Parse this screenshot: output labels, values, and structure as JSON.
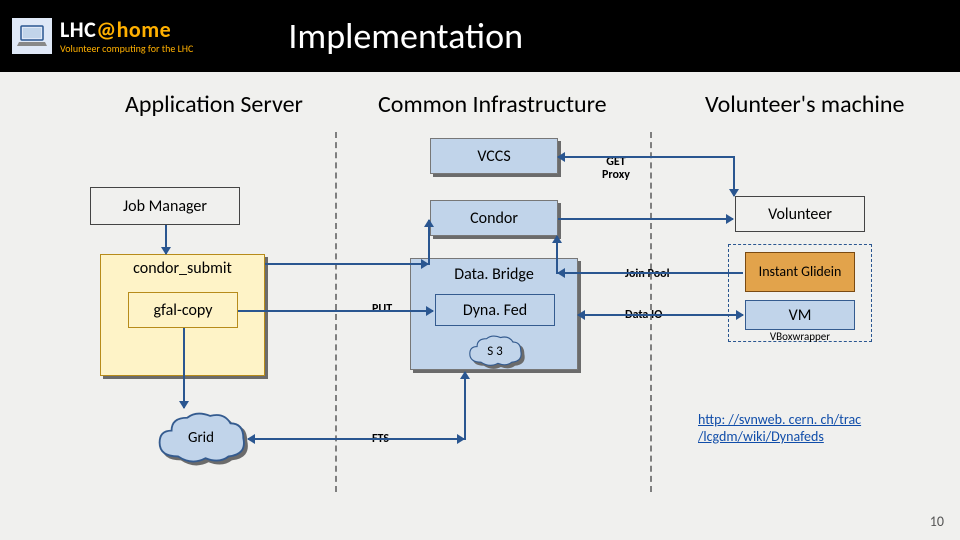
{
  "header": {
    "brand_prefix": "LHC",
    "brand_suffix": "@home",
    "tagline": "Volunteer computing for the LHC",
    "title": "Implementation"
  },
  "columns": {
    "left": "Application Server",
    "mid": "Common Infrastructure",
    "right": "Volunteer's machine"
  },
  "boxes": {
    "job_manager": "Job Manager",
    "condor_submit": "condor_submit",
    "gfal_copy": "gfal-copy",
    "vccs": "VCCS",
    "condor": "Condor",
    "data_bridge": "Data. Bridge",
    "dyna_fed": "Dyna. Fed",
    "volunteer": "Volunteer",
    "instant_glidein": "Instant Glidein",
    "vm": "VM",
    "vbox_wrapper": "VBoxwrapper"
  },
  "clouds": {
    "grid": "Grid",
    "s3": "S 3"
  },
  "labels": {
    "get_proxy1": "GET",
    "get_proxy2": "Proxy",
    "put": "PUT",
    "fts": "FTS",
    "join_pool": "Join Pool",
    "data_io": "Data IO"
  },
  "link": {
    "line1": "http: //svnweb. cern. ch/trac",
    "line2": "/lcgdm/wiki/Dynafeds"
  },
  "page": "10"
}
